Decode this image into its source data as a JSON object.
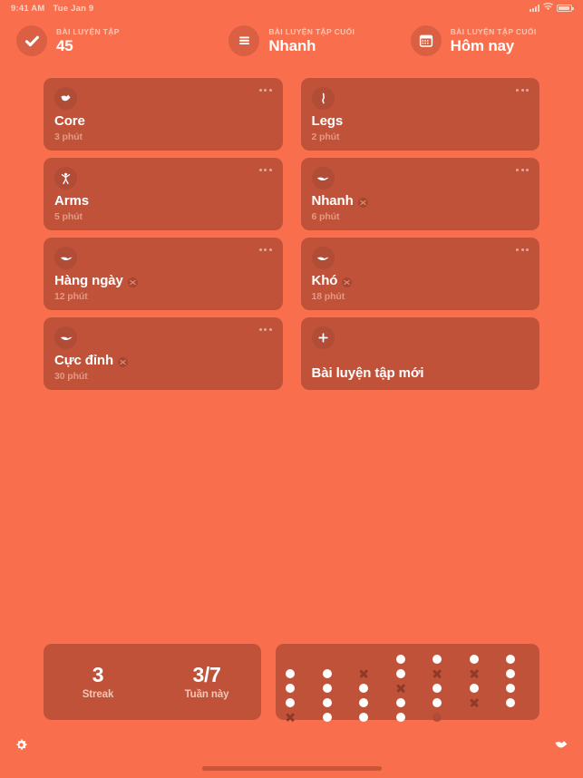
{
  "status_bar": {
    "time": "9:41 AM",
    "date": "Tue Jan 9",
    "signal_icon": "cellular-signal-icon",
    "wifi_icon": "wifi-icon",
    "battery_icon": "battery-icon"
  },
  "header": {
    "stats": [
      {
        "icon": "checkmark-icon",
        "label": "BÀI LUYỆN TẬP",
        "value": "45"
      },
      {
        "icon": "list-icon",
        "label": "BÀI LUYỆN TẬP CUỐI",
        "value": "Nhanh"
      },
      {
        "icon": "calendar-icon",
        "label": "BÀI LUYỆN TẬP CUỐI",
        "value": "Hôm nay"
      }
    ]
  },
  "workouts": [
    {
      "icon": "core-exercise-icon",
      "title": "Core",
      "duration": "3 phút",
      "badge": false,
      "menu": "more-options-icon"
    },
    {
      "icon": "legs-exercise-icon",
      "title": "Legs",
      "duration": "2 phút",
      "badge": false,
      "menu": "more-options-icon"
    },
    {
      "icon": "arms-exercise-icon",
      "title": "Arms",
      "duration": "5 phút",
      "badge": false,
      "menu": "more-options-icon"
    },
    {
      "icon": "wing-exercise-icon",
      "title": "Nhanh",
      "duration": "6 phút",
      "badge": true,
      "menu": "more-options-icon"
    },
    {
      "icon": "wing-exercise-icon",
      "title": "Hàng ngày",
      "duration": "12 phút",
      "badge": true,
      "menu": "more-options-icon"
    },
    {
      "icon": "wing-exercise-icon",
      "title": "Khó",
      "duration": "18 phút",
      "badge": true,
      "menu": "more-options-icon"
    },
    {
      "icon": "wing-exercise-icon",
      "title": "Cực đỉnh",
      "duration": "30 phút",
      "badge": true,
      "menu": "more-options-icon"
    }
  ],
  "new_workout": {
    "icon": "plus-icon",
    "title": "Bài luyện tập mới"
  },
  "stats_panel": {
    "streak": {
      "value": "3",
      "label": "Streak"
    },
    "week": {
      "value": "3/7",
      "label": "Tuần này"
    }
  },
  "history": {
    "columns": [
      {
        "top_offset": 1,
        "marks": [
          "done",
          "done",
          "done",
          "miss"
        ]
      },
      {
        "top_offset": 1,
        "marks": [
          "done",
          "done",
          "done",
          "done"
        ]
      },
      {
        "top_offset": 1,
        "marks": [
          "miss",
          "done",
          "done",
          "done"
        ]
      },
      {
        "top_offset": 0,
        "marks": [
          "done",
          "done",
          "miss",
          "done",
          "done"
        ]
      },
      {
        "top_offset": 0,
        "marks": [
          "done",
          "miss",
          "done",
          "done",
          "faint"
        ]
      },
      {
        "top_offset": 0,
        "marks": [
          "done",
          "miss",
          "done",
          "miss"
        ]
      },
      {
        "top_offset": 0,
        "marks": [
          "done",
          "done",
          "done",
          "done"
        ]
      }
    ]
  },
  "bottom_bar": {
    "settings_icon": "gear-icon",
    "brand_icon": "app-logo-icon",
    "home_indicator": "home-indicator"
  },
  "colors": {
    "background": "#f96f4e",
    "card": "#c0523a",
    "card_icon_circle": "#b14c36",
    "text_primary": "#ffffff",
    "text_secondary": "#e09b85",
    "header_label": "#fbc6b3",
    "mark_miss": "#8e3a27"
  }
}
